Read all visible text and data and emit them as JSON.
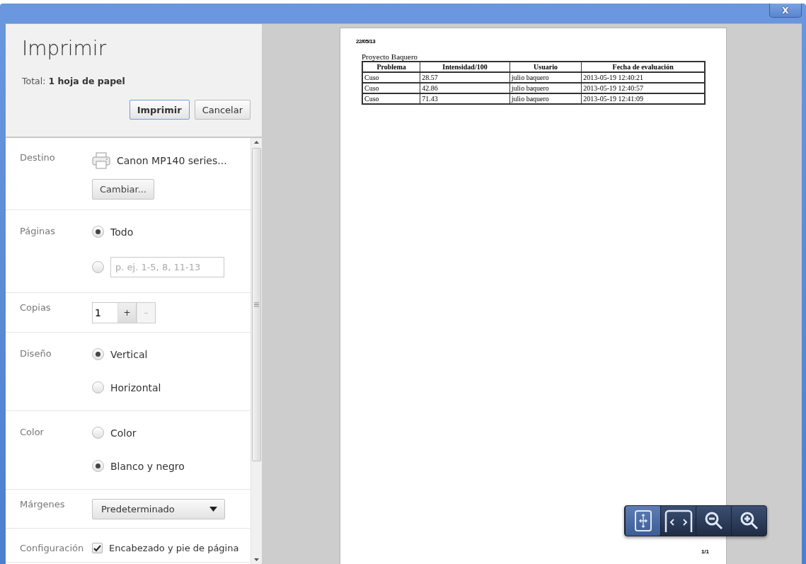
{
  "window": {
    "close": "X"
  },
  "header": {
    "title": "Imprimir",
    "total": "Total: **1 hoja de papel**",
    "buttons": [
      {
        "label": "Imprimir",
        "primary": true
      },
      {
        "label": "Cancelar",
        "primary": false
      }
    ]
  },
  "settings": [
    {
      "kind": "destination",
      "label": "Destino",
      "printer": "Canon MP140 series...",
      "button": "Cambiar..."
    },
    {
      "kind": "radios",
      "label": "Páginas",
      "options": [
        {
          "label": "Todo",
          "selected": true
        },
        {
          "placeholder": "p. ej. 1-5, 8, 11-13",
          "selected": false
        }
      ]
    },
    {
      "kind": "copies",
      "label": "Copias",
      "value": "1",
      "plus": "+",
      "minus": "–"
    },
    {
      "kind": "radios",
      "label": "Diseño",
      "options": [
        {
          "label": "Vertical",
          "selected": true
        },
        {
          "label": "Horizontal",
          "selected": false
        }
      ]
    },
    {
      "kind": "radios",
      "label": "Color",
      "options": [
        {
          "label": "Color",
          "selected": false
        },
        {
          "label": "Blanco y negro",
          "selected": true
        }
      ]
    },
    {
      "kind": "select",
      "label": "Márgenes",
      "value": "Predeterminado"
    },
    {
      "kind": "checkbox",
      "label": "Configuración",
      "option": "Encabezado y pie de página",
      "checked": true
    }
  ],
  "preview": {
    "date": "22/05/13",
    "title": "Proyecto Baquero",
    "columns": [
      "Problema",
      "Intensidad/100",
      "Usuario",
      "Fecha de evaluación"
    ],
    "rows": [
      [
        "Cuso",
        "28.57",
        "julio baquero",
        "2013-05-19 12:40:21"
      ],
      [
        "Cuso",
        "42.86",
        "julio baquero",
        "2013-05-19 12:40:57"
      ],
      [
        "Cuso",
        "71.43",
        "julio baquero",
        "2013-05-19 12:41:09"
      ]
    ],
    "page_number": "1/1",
    "zoom_tools": [
      {
        "kind": "fit",
        "selected": true
      },
      {
        "kind": "fit-width",
        "selected": false
      },
      {
        "kind": "zoom-out",
        "selected": false
      },
      {
        "kind": "zoom-in",
        "selected": false
      }
    ]
  }
}
